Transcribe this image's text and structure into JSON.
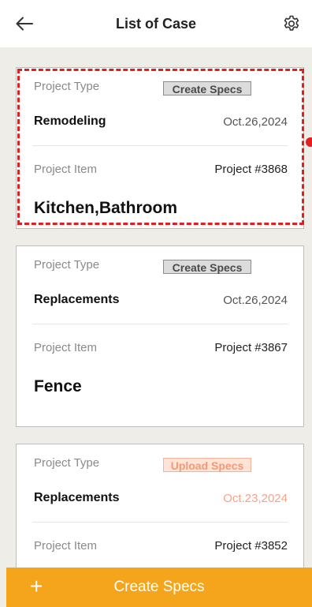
{
  "header": {
    "title": "List of Case",
    "back_icon": "arrow-left-icon",
    "settings_icon": "gear-icon"
  },
  "cases": [
    {
      "type_label": "Project Type",
      "spec_button": "Create Specs",
      "type_value": "Remodeling",
      "date": "Oct.26,2024",
      "item_label": "Project Item",
      "project_number": "Project #3868",
      "item_value": "Kitchen,Bathroom"
    },
    {
      "type_label": "Project Type",
      "spec_button": "Create Specs",
      "type_value": "Replacements",
      "date": "Oct.26,2024",
      "item_label": "Project Item",
      "project_number": "Project #3867",
      "item_value": "Fence"
    },
    {
      "type_label": "Project Type",
      "spec_button": "Upload Specs",
      "type_value": "Replacements",
      "date": "Oct.23,2024",
      "item_label": "Project Item",
      "project_number": "Project #3852"
    }
  ],
  "bottom_bar": {
    "plus": "+",
    "label": "Create Specs"
  },
  "colors": {
    "accent": "#f5a51b",
    "highlight": "#e02020",
    "upload_badge": "#f29a78"
  }
}
